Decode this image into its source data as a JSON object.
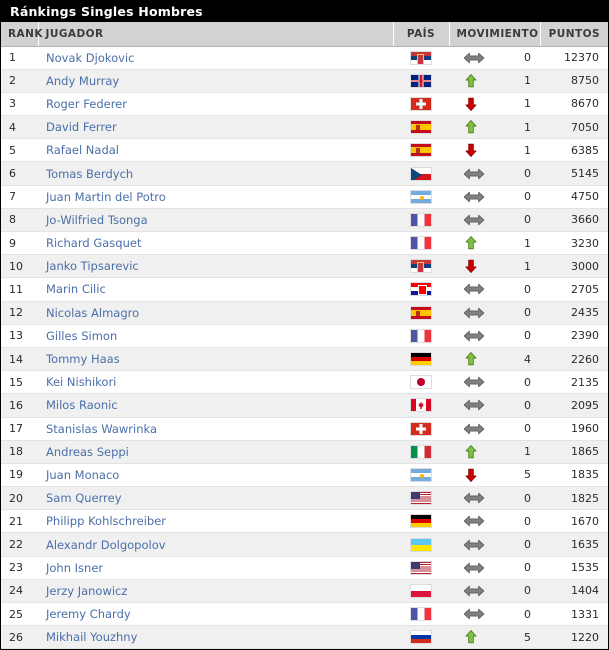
{
  "title": "Ránkings Singles Hombres",
  "columns": {
    "rank": "RANK",
    "player": "JUGADOR",
    "country": "PAÍS",
    "movement": "MOVIMIENTO",
    "points": "PUNTOS"
  },
  "colors": {
    "title_bar_bg": "#000000",
    "header_bg": "#d2d2d2",
    "row_alt_bg": "#f0f0f0",
    "link": "#4a6fa8",
    "arrow_up": "#7cc243",
    "arrow_down": "#cc0000",
    "arrow_same": "#808080"
  },
  "icons": {
    "up": "arrow-up-icon",
    "down": "arrow-down-icon",
    "same": "arrow-left-right-icon"
  },
  "rows": [
    {
      "rank": "1",
      "player": "Novak Djokovic",
      "country": "SRB",
      "direction": "same",
      "change": "0",
      "points": "12370"
    },
    {
      "rank": "2",
      "player": "Andy Murray",
      "country": "GBR",
      "direction": "up",
      "change": "1",
      "points": "8750"
    },
    {
      "rank": "3",
      "player": "Roger Federer",
      "country": "SUI",
      "direction": "down",
      "change": "1",
      "points": "8670"
    },
    {
      "rank": "4",
      "player": "David Ferrer",
      "country": "ESP",
      "direction": "up",
      "change": "1",
      "points": "7050"
    },
    {
      "rank": "5",
      "player": "Rafael Nadal",
      "country": "ESP",
      "direction": "down",
      "change": "1",
      "points": "6385"
    },
    {
      "rank": "6",
      "player": "Tomas Berdych",
      "country": "CZE",
      "direction": "same",
      "change": "0",
      "points": "5145"
    },
    {
      "rank": "7",
      "player": "Juan Martin del Potro",
      "country": "ARG",
      "direction": "same",
      "change": "0",
      "points": "4750"
    },
    {
      "rank": "8",
      "player": "Jo-Wilfried Tsonga",
      "country": "FRA",
      "direction": "same",
      "change": "0",
      "points": "3660"
    },
    {
      "rank": "9",
      "player": "Richard Gasquet",
      "country": "FRA",
      "direction": "up",
      "change": "1",
      "points": "3230"
    },
    {
      "rank": "10",
      "player": "Janko Tipsarevic",
      "country": "SRB",
      "direction": "down",
      "change": "1",
      "points": "3000"
    },
    {
      "rank": "11",
      "player": "Marin Cilic",
      "country": "CRO",
      "direction": "same",
      "change": "0",
      "points": "2705"
    },
    {
      "rank": "12",
      "player": "Nicolas Almagro",
      "country": "ESP",
      "direction": "same",
      "change": "0",
      "points": "2435"
    },
    {
      "rank": "13",
      "player": "Gilles Simon",
      "country": "FRA",
      "direction": "same",
      "change": "0",
      "points": "2390"
    },
    {
      "rank": "14",
      "player": "Tommy Haas",
      "country": "GER",
      "direction": "up",
      "change": "4",
      "points": "2260"
    },
    {
      "rank": "15",
      "player": "Kei Nishikori",
      "country": "JPN",
      "direction": "same",
      "change": "0",
      "points": "2135"
    },
    {
      "rank": "16",
      "player": "Milos Raonic",
      "country": "CAN",
      "direction": "same",
      "change": "0",
      "points": "2095"
    },
    {
      "rank": "17",
      "player": "Stanislas Wawrinka",
      "country": "SUI",
      "direction": "same",
      "change": "0",
      "points": "1960"
    },
    {
      "rank": "18",
      "player": "Andreas Seppi",
      "country": "ITA",
      "direction": "up",
      "change": "1",
      "points": "1865"
    },
    {
      "rank": "19",
      "player": "Juan Monaco",
      "country": "ARG",
      "direction": "down",
      "change": "5",
      "points": "1835"
    },
    {
      "rank": "20",
      "player": "Sam Querrey",
      "country": "USA",
      "direction": "same",
      "change": "0",
      "points": "1825"
    },
    {
      "rank": "21",
      "player": "Philipp Kohlschreiber",
      "country": "GER",
      "direction": "same",
      "change": "0",
      "points": "1670"
    },
    {
      "rank": "22",
      "player": "Alexandr Dolgopolov",
      "country": "UKR",
      "direction": "same",
      "change": "0",
      "points": "1635"
    },
    {
      "rank": "23",
      "player": "John Isner",
      "country": "USA",
      "direction": "same",
      "change": "0",
      "points": "1535"
    },
    {
      "rank": "24",
      "player": "Jerzy Janowicz",
      "country": "POL",
      "direction": "same",
      "change": "0",
      "points": "1404"
    },
    {
      "rank": "25",
      "player": "Jeremy Chardy",
      "country": "FRA",
      "direction": "same",
      "change": "0",
      "points": "1331"
    },
    {
      "rank": "26",
      "player": "Mikhail Youzhny",
      "country": "RUS",
      "direction": "up",
      "change": "5",
      "points": "1220"
    }
  ]
}
